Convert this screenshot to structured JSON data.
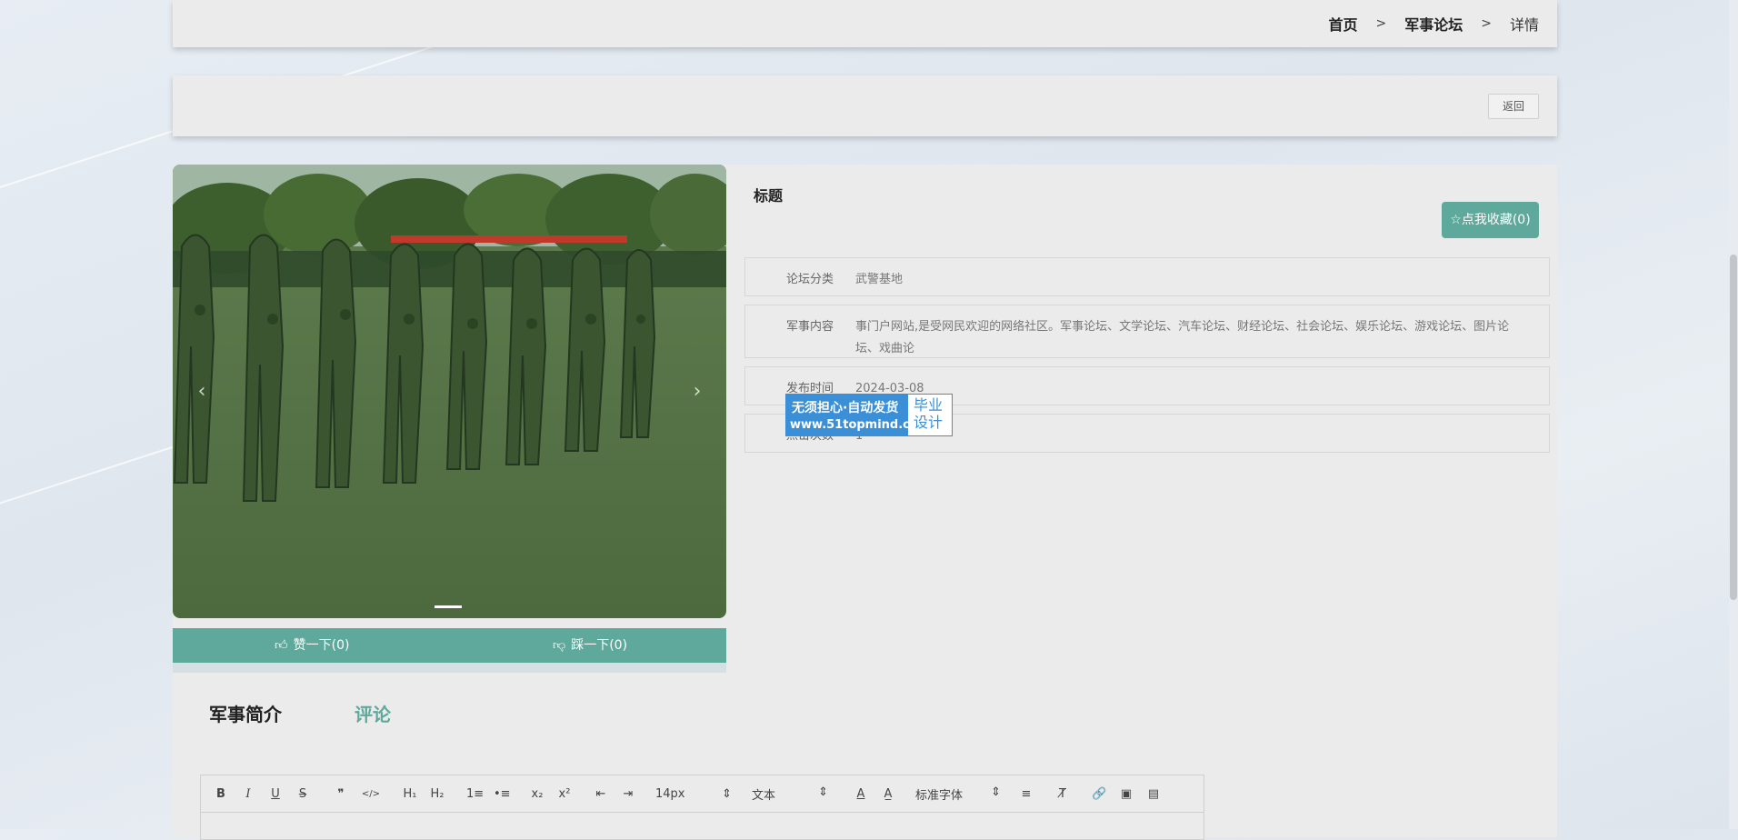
{
  "breadcrumb": {
    "home": "首页",
    "sep1": ">",
    "section": "军事论坛",
    "sep2": ">",
    "current": "详情"
  },
  "back_button": "返回",
  "detail": {
    "title_label": "标题",
    "favorite_button": "☆点我收藏(0)",
    "rows": [
      {
        "label": "论坛分类",
        "value": "武警基地"
      },
      {
        "label": "军事内容",
        "value": "事门户网站,是受网民欢迎的网络社区。军事论坛、文学论坛、汽车论坛、财经论坛、社会论坛、娱乐论坛、游戏论坛、图片论坛、戏曲论"
      },
      {
        "label": "发布时间",
        "value": "2024-03-08"
      },
      {
        "label": "点击次数",
        "value": "1"
      }
    ]
  },
  "vote": {
    "like": "赞一下(0)",
    "dislike": "踩一下(0)"
  },
  "watermark": {
    "line1": "无须担心·自动发货",
    "line2": "www.51topmind.com",
    "right1": "毕业",
    "right2": "设计"
  },
  "tabs": [
    {
      "label": "军事简介"
    },
    {
      "label": "评论"
    }
  ],
  "editor": {
    "font_size": "14px",
    "block_type": "文本",
    "font_family": "标准字体",
    "buttons": {
      "bold": "B",
      "italic": "I",
      "underline": "U",
      "strike": "S",
      "quote": "❞",
      "code": "</>",
      "h1": "H₁",
      "h2": "H₂",
      "ol": "1≡",
      "ul": "•≡",
      "sub": "x₂",
      "sup": "x²",
      "outdent": "⇤",
      "indent": "⇥",
      "color": "A",
      "bg": "A̲",
      "align": "≡",
      "clean": "T̸",
      "link": "🔗",
      "image": "▣",
      "video": "▤"
    }
  },
  "colors": {
    "accent": "#5fa89c",
    "panel": "#ebebeb",
    "watermark_blue": "#3a8fd6"
  }
}
